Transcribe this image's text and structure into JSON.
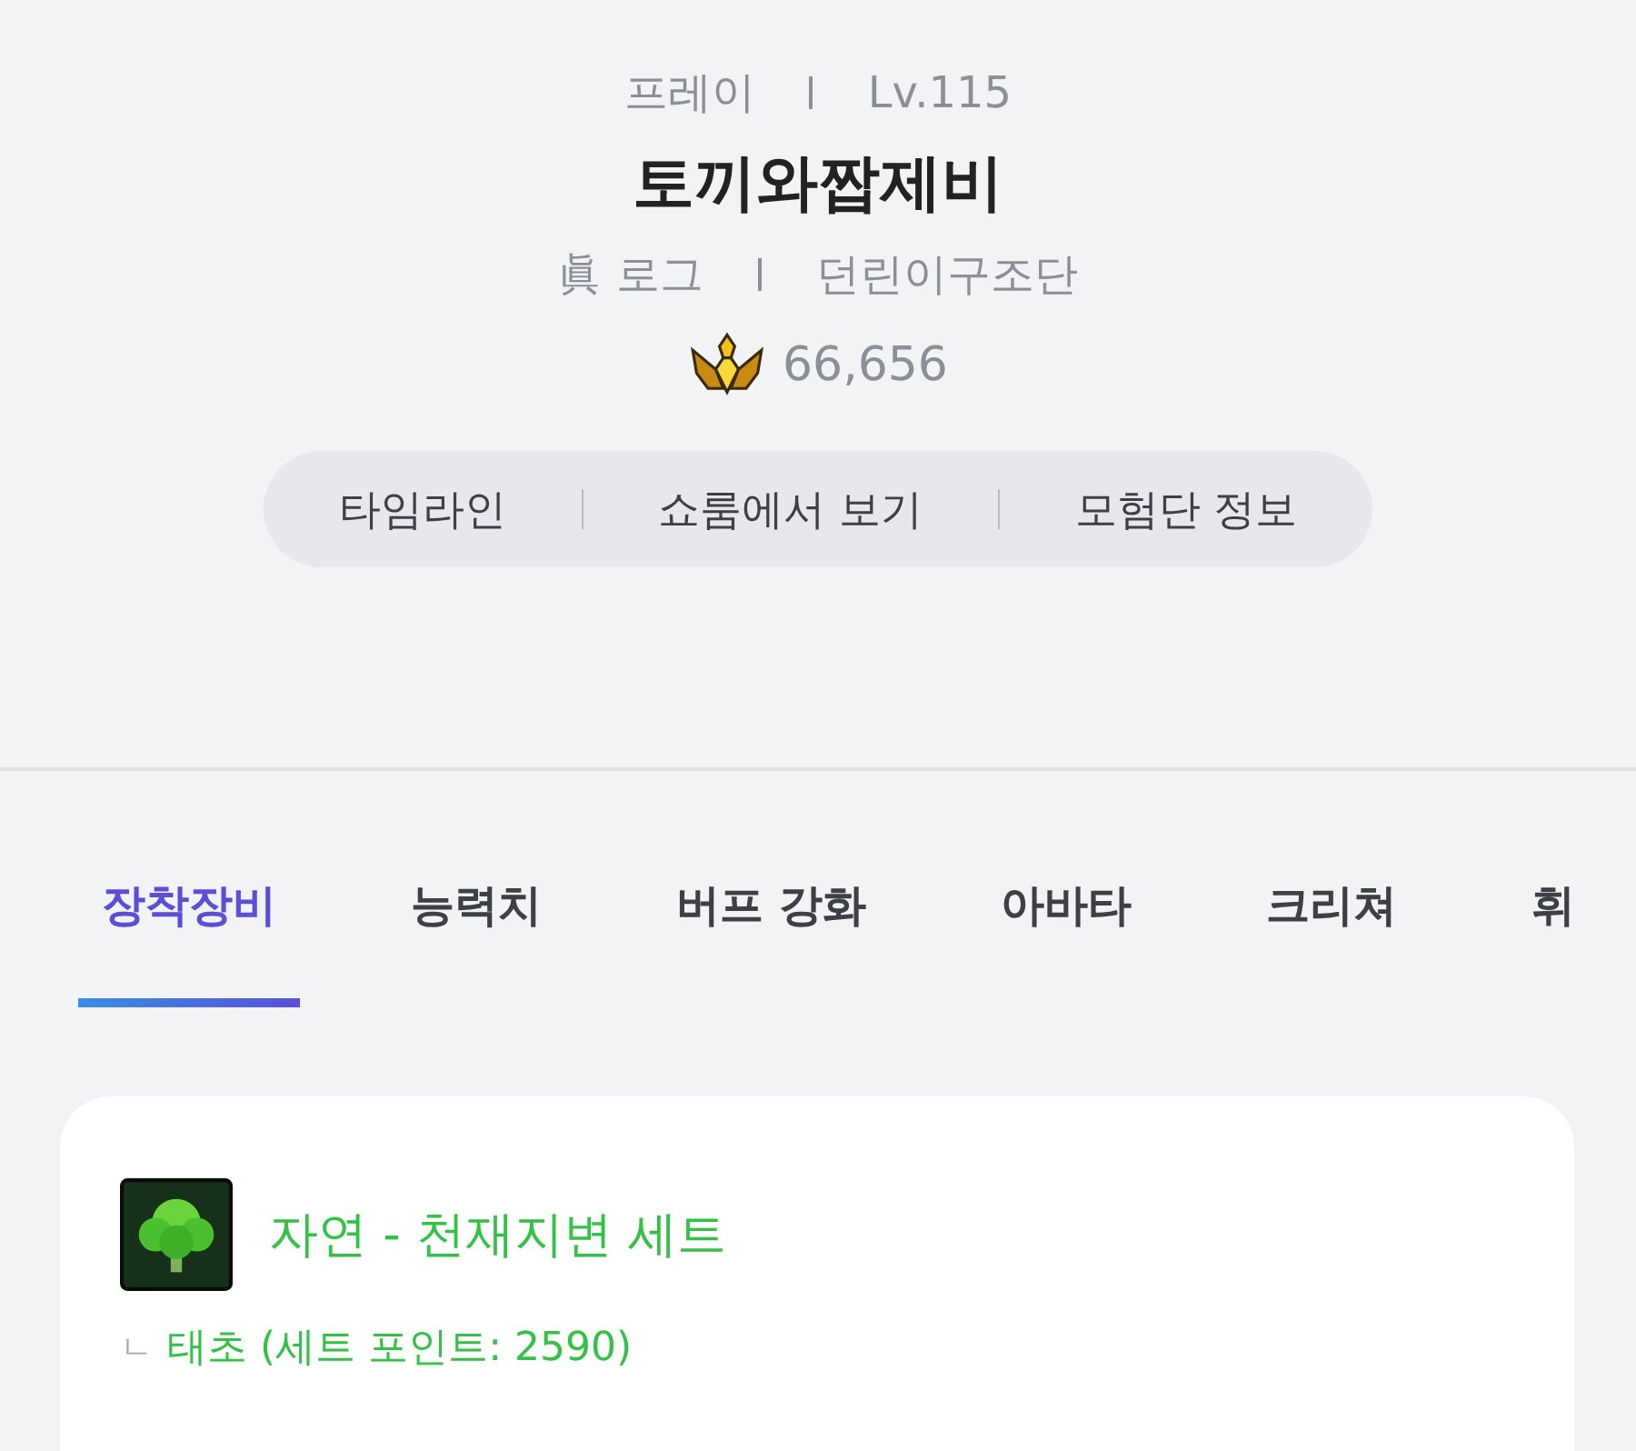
{
  "profile": {
    "job": "프레이",
    "level": "Lv.115",
    "name": "토끼와짭제비",
    "world": "眞 로그",
    "guild": "던린이구조단",
    "score": "66,656"
  },
  "links": [
    "타임라인",
    "쇼룸에서 보기",
    "모험단 정보"
  ],
  "tabs": [
    {
      "label": "장착장비",
      "selected": true
    },
    {
      "label": "능력치",
      "selected": false
    },
    {
      "label": "버프 강화",
      "selected": false
    },
    {
      "label": "아바타",
      "selected": false
    },
    {
      "label": "크리쳐",
      "selected": false
    },
    {
      "label": "휘",
      "selected": false
    }
  ],
  "set_card": {
    "title": "자연 - 천재지변 세트",
    "branch_mark": "ㄴ",
    "detail": "태초 (세트 포인트: 2590)"
  }
}
